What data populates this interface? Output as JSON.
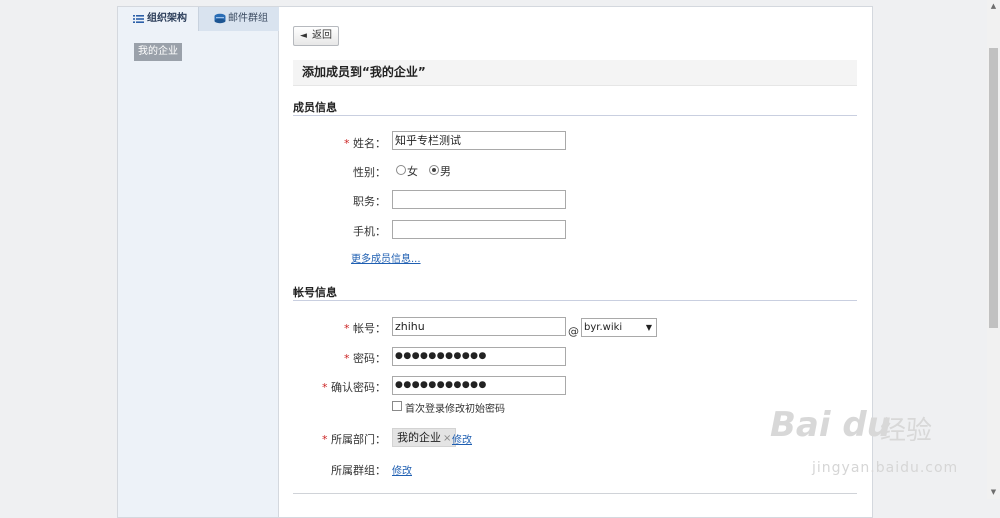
{
  "sidebar": {
    "tabs": [
      {
        "label": "组织架构",
        "icon": "list-icon"
      },
      {
        "label": "邮件群组",
        "icon": "mail-group-icon"
      }
    ],
    "tree": [
      {
        "label": "我的企业"
      }
    ]
  },
  "toolbar": {
    "back_label": "返回"
  },
  "page": {
    "title": "添加成员到“我的企业”"
  },
  "member_info": {
    "section_title": "成员信息",
    "name_label": "姓名：",
    "name_value": "知乎专栏测试",
    "gender_label": "性别：",
    "gender_options": [
      {
        "label": "女",
        "checked": false
      },
      {
        "label": "男",
        "checked": true
      }
    ],
    "position_label": "职务：",
    "position_value": "",
    "mobile_label": "手机：",
    "mobile_value": "",
    "more_link": "更多成员信息..."
  },
  "account_info": {
    "section_title": "帐号信息",
    "account_label": "帐号：",
    "account_value": "zhihu",
    "at_symbol": "@",
    "domain_selected": "byr.wiki",
    "password_label": "密码：",
    "password_value": "●●●●●●●●●●●",
    "confirm_label": "确认密码：",
    "confirm_value": "●●●●●●●●●●●",
    "first_login_checkbox": "首次登录修改初始密码",
    "first_login_checked": false,
    "dept_label": "所属部门：",
    "dept_value": "我的企业",
    "dept_remove": "×",
    "dept_edit": "修改",
    "group_label": "所属群组：",
    "group_edit": "修改"
  },
  "required_mark": "*",
  "watermark": {
    "brand": "Bai du",
    "cn": "经验",
    "url": "jingyan.baidu.com"
  },
  "colors": {
    "link": "#1f5fb2",
    "required": "#cc2222",
    "sidebar_bg": "#edf2f8",
    "section_line": "#c9cfe0"
  }
}
